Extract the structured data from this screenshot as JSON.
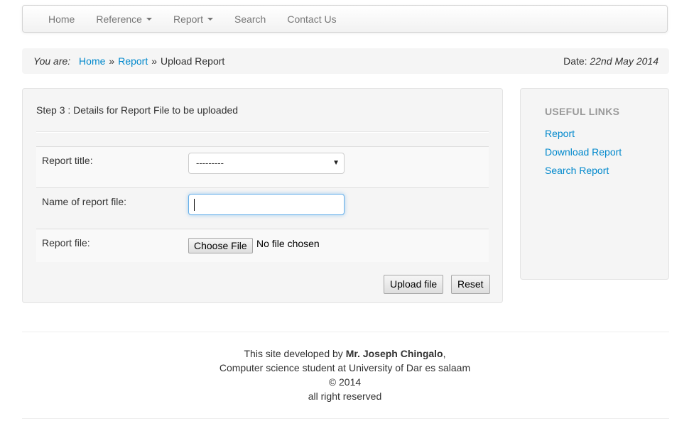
{
  "nav": {
    "items": [
      {
        "label": "Home",
        "dropdown": false
      },
      {
        "label": "Reference",
        "dropdown": true
      },
      {
        "label": "Report",
        "dropdown": true
      },
      {
        "label": "Search",
        "dropdown": false
      },
      {
        "label": "Contact Us",
        "dropdown": false
      }
    ]
  },
  "breadcrumb": {
    "prefix": "You are:",
    "items": [
      "Home",
      "Report"
    ],
    "separator": "»",
    "current": "Upload Report"
  },
  "date": {
    "label": "Date:",
    "value": "22nd May 2014"
  },
  "form": {
    "step_title": "Step 3 : Details for Report File to be uploaded",
    "title_label": "Report title:",
    "title_selected": "---------",
    "filename_label": "Name of report file:",
    "filename_value": "",
    "file_label": "Report file:",
    "file_button": "Choose File",
    "file_status": "No file chosen",
    "upload_label": "Upload file",
    "reset_label": "Reset"
  },
  "sidebar": {
    "header": "USEFUL LINKS",
    "links": [
      "Report",
      "Download Report",
      "Search Report"
    ]
  },
  "footer": {
    "line1_prefix": "This site developed by ",
    "developer": "Mr. Joseph Chingalo",
    "line1_suffix": ",",
    "line2": "Computer science student at University of Dar es salaam",
    "line3": "© 2014",
    "line4": "all right reserved"
  },
  "colors": {
    "link": "#0088cc",
    "nav_text": "#777777",
    "focus_border": "#66afe9",
    "sidebar_header": "#999999"
  }
}
